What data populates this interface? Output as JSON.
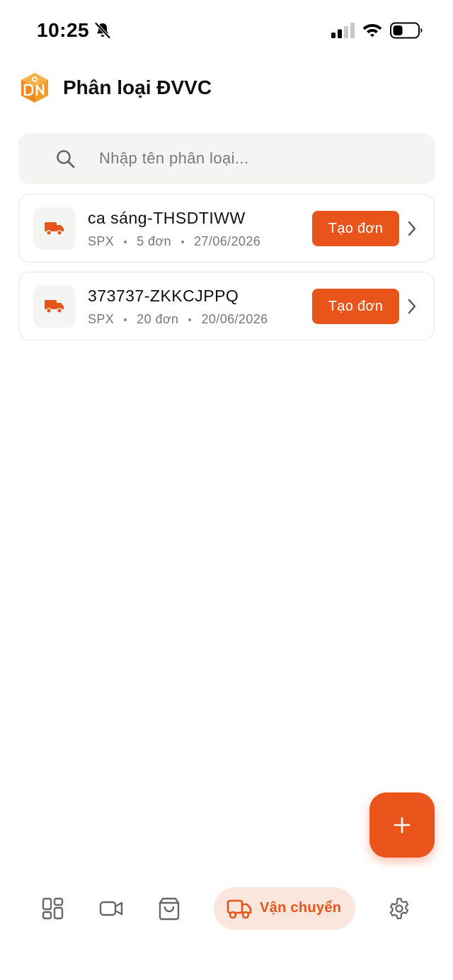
{
  "status_bar": {
    "time": "10:25"
  },
  "header": {
    "title": "Phân loại ĐVVC"
  },
  "search": {
    "placeholder": "Nhập tên phân loại..."
  },
  "items": [
    {
      "title": "ca sáng-THSDTIWW",
      "carrier": "SPX",
      "orders": "5 đơn",
      "date": "27/06/2026",
      "action_label": "Tạo đơn"
    },
    {
      "title": "373737-ZKKCJPPQ",
      "carrier": "SPX",
      "orders": "20 đơn",
      "date": "20/06/2026",
      "action_label": "Tạo đơn"
    }
  ],
  "bottom_nav": {
    "items": [
      {
        "icon": "grid-icon"
      },
      {
        "icon": "video-camera-icon"
      },
      {
        "icon": "shopping-bag-icon"
      },
      {
        "icon": "truck-icon",
        "label": "Vận chuyển",
        "active": true
      },
      {
        "icon": "gear-icon"
      }
    ]
  },
  "colors": {
    "accent": "#E8541A",
    "accent_light": "#FBE6DD",
    "surface": "#F4F4F3"
  }
}
